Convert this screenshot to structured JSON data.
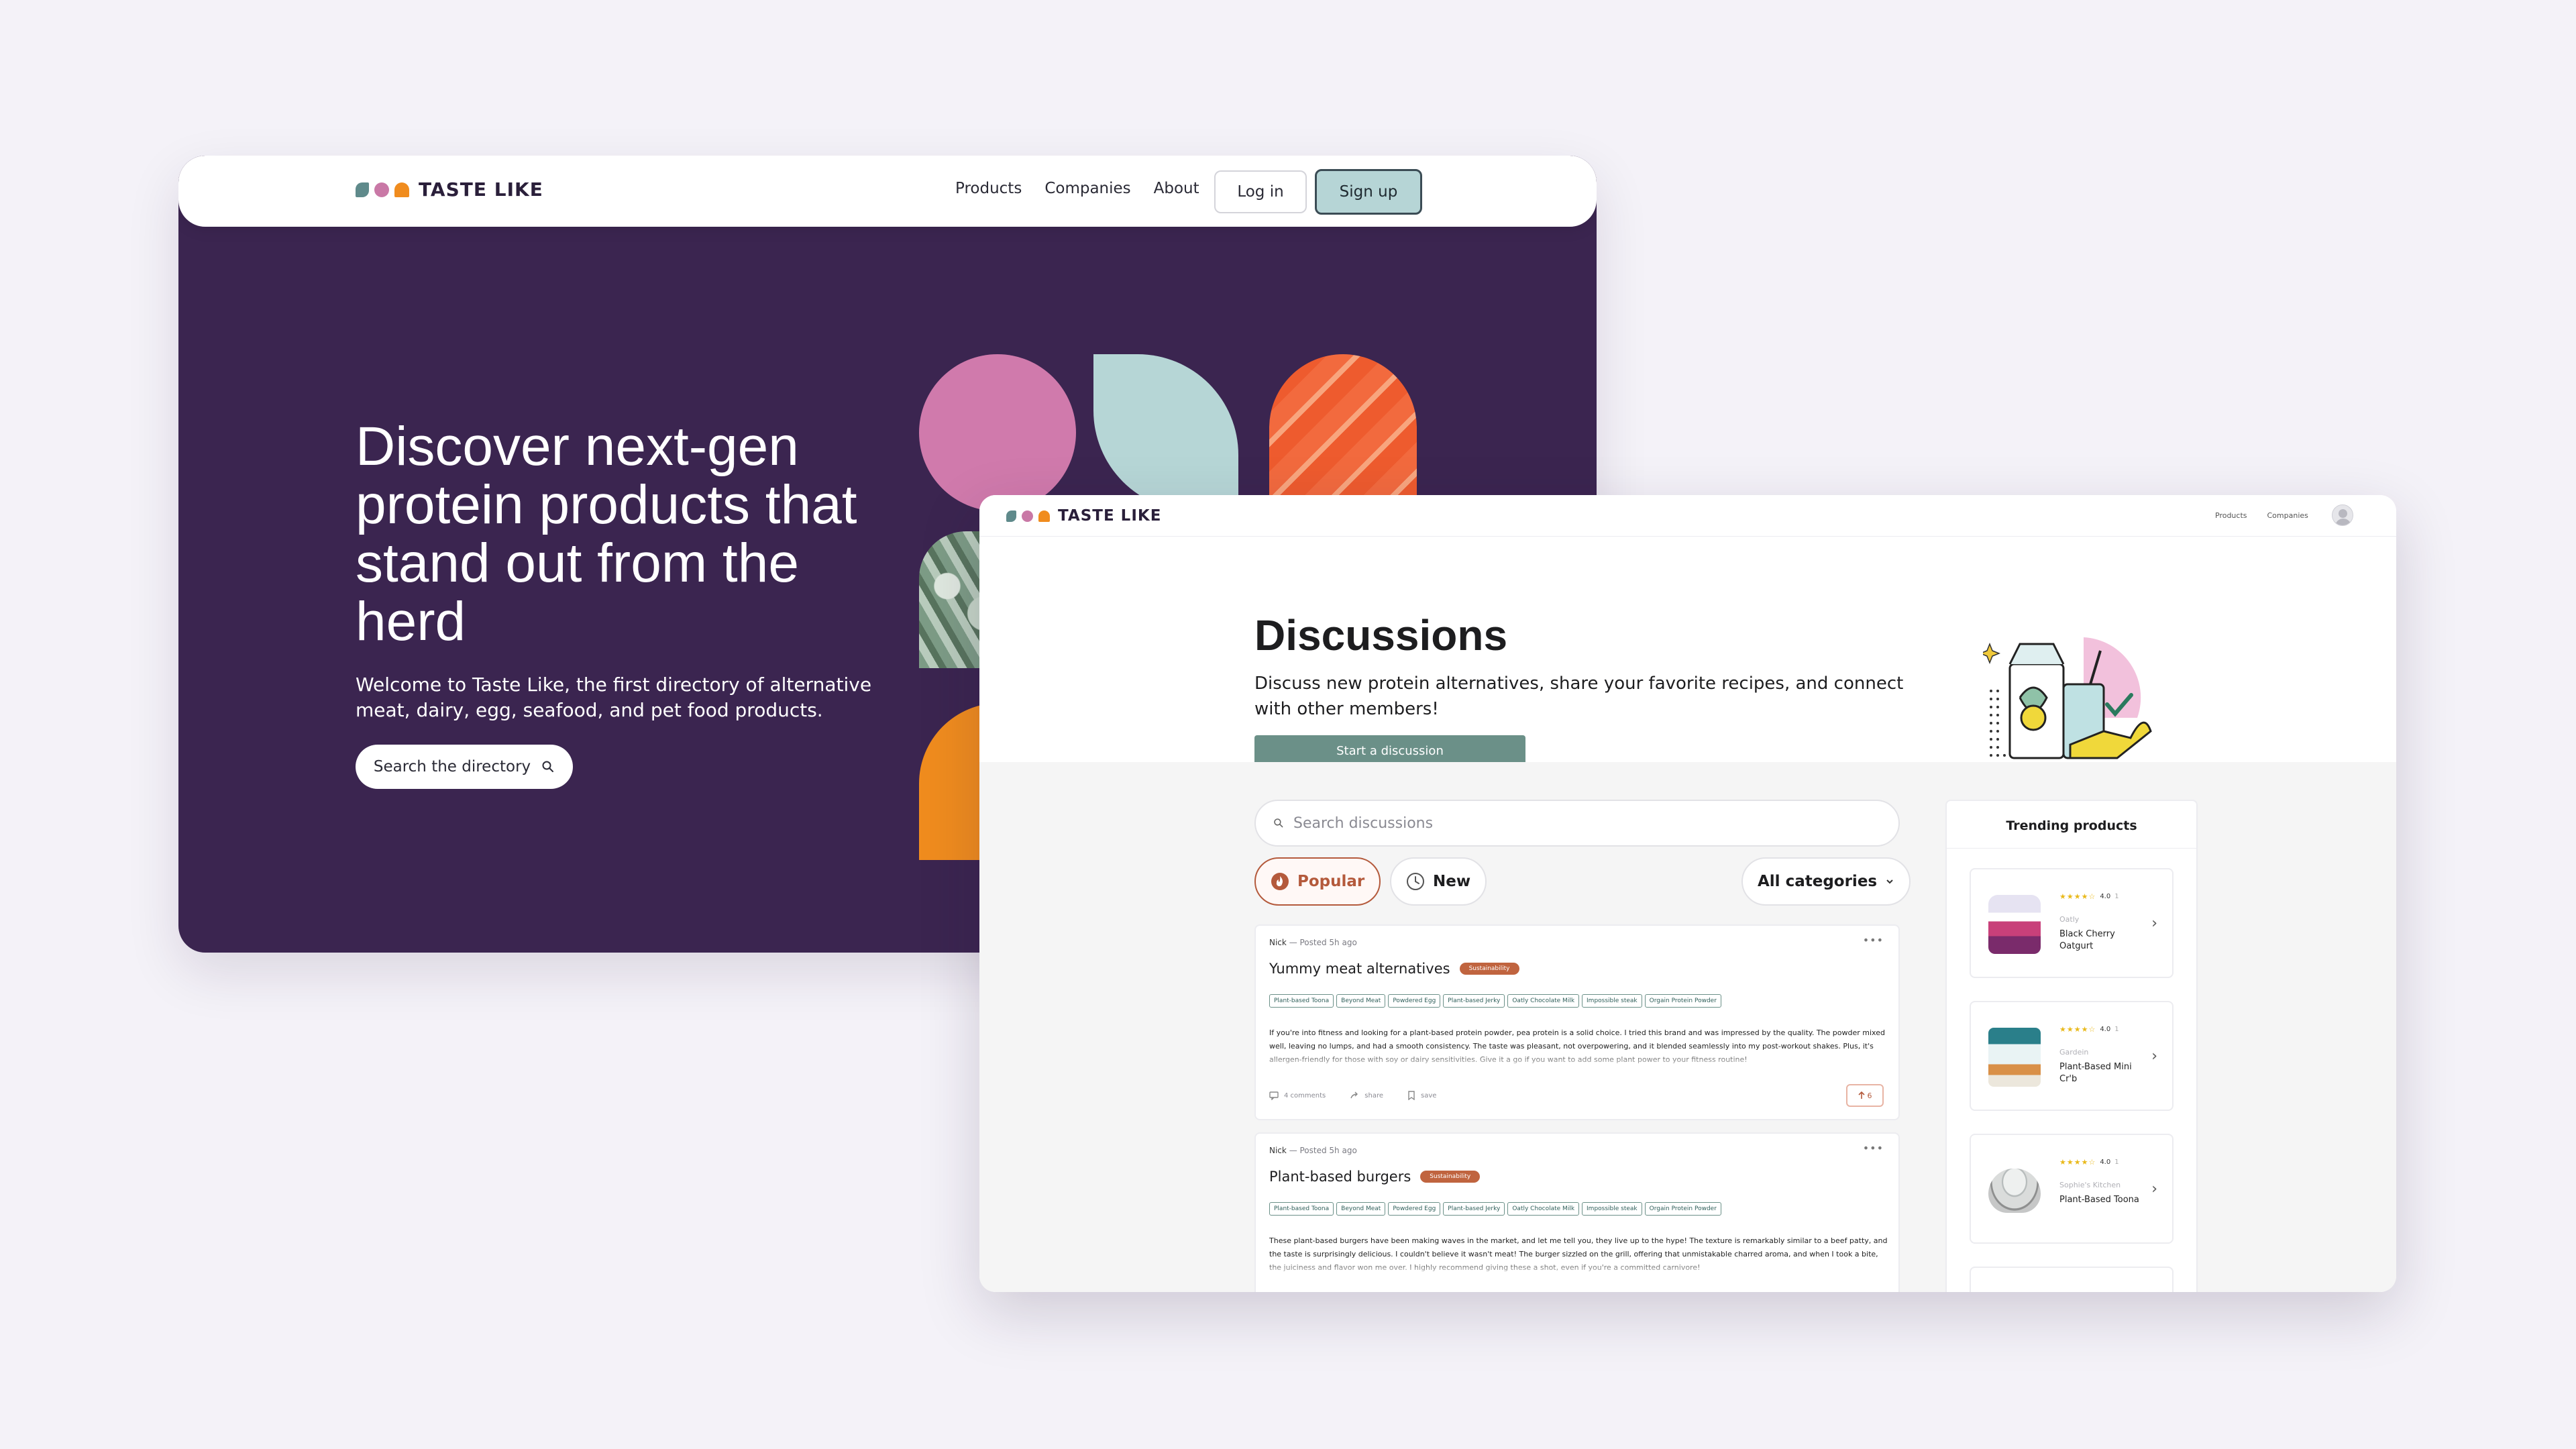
{
  "colors": {
    "purple_bg": "#3b2550",
    "teal_button": "#6b9088",
    "signup_bg": "#b6d5d6",
    "accent_rust": "#b45a3c",
    "logo_teal": "#5f8a8b",
    "logo_pink": "#c978a6",
    "logo_orange": "#f08c1e"
  },
  "landing": {
    "logo_text": "TASTE LIKE",
    "nav": [
      "Products",
      "Companies",
      "About"
    ],
    "login_label": "Log in",
    "signup_label": "Sign up",
    "hero_title": "Discover next-gen protein products that stand out from the herd",
    "hero_subtitle": "Welcome to Taste Like, the first directory of alternative meat, dairy, egg, seafood, and pet food products.",
    "search_button": "Search the directory"
  },
  "discussions": {
    "logo_text": "TASTE LIKE",
    "nav": [
      "Products",
      "Companies"
    ],
    "title": "Discussions",
    "subtitle": "Discuss new protein alternatives, share your favorite recipes, and connect with other members!",
    "start_button": "Start a discussion",
    "search_placeholder": "Search discussions",
    "filters": {
      "popular": "Popular",
      "new": "New",
      "categories": "All categories"
    },
    "posts": [
      {
        "author": "Nick",
        "posted": "— Posted 5h ago",
        "title": "Yummy meat alternatives",
        "tag": "Sustainability",
        "chips": [
          "Plant-based Toona",
          "Beyond Meat",
          "Powdered Egg",
          "Plant-based Jerky",
          "Oatly Chocolate Milk",
          "Impossible steak",
          "Orgain Protein Powder"
        ],
        "text": "If you're into fitness and looking for a plant-based protein powder, pea protein is a solid choice. I tried this brand and was impressed by the quality. The powder mixed well, leaving no lumps, and had a smooth consistency. The taste was pleasant, not overpowering, and it blended seamlessly into my post-workout shakes. Plus, it's allergen-friendly for those with soy or dairy sensitivities. Give it a go if you want to add some plant power to your fitness routine!",
        "comments": "4 comments",
        "share": "share",
        "save": "save",
        "votes": "6"
      },
      {
        "author": "Nick",
        "posted": "— Posted 5h ago",
        "title": "Plant-based burgers",
        "tag": "Sustainability",
        "chips": [
          "Plant-based Toona",
          "Beyond Meat",
          "Powdered Egg",
          "Plant-based Jerky",
          "Oatly Chocolate Milk",
          "Impossible steak",
          "Orgain Protein Powder"
        ],
        "text": "These plant-based burgers have been making waves in the market, and let me tell you, they live up to the hype! The texture is remarkably similar to a beef patty, and the taste is surprisingly delicious. I couldn't believe it wasn't meat! The burger sizzled on the grill, offering that unmistakable charred aroma, and when I took a bite, the juiciness and flavor won me over. I highly recommend giving these a shot, even if you're a committed carnivore!"
      }
    ],
    "trending": {
      "title": "Trending products",
      "items": [
        {
          "stars": "★★★★☆",
          "rating": "4.0",
          "count": "1",
          "brand": "Oatly",
          "name": "Black Cherry Oatgurt"
        },
        {
          "stars": "★★★★☆",
          "rating": "4.0",
          "count": "1",
          "brand": "Gardein",
          "name": "Plant-Based Mini Cr'b"
        },
        {
          "stars": "★★★★☆",
          "rating": "4.0",
          "count": "1",
          "brand": "Sophie's Kitchen",
          "name": "Plant-Based Toona"
        }
      ]
    }
  }
}
